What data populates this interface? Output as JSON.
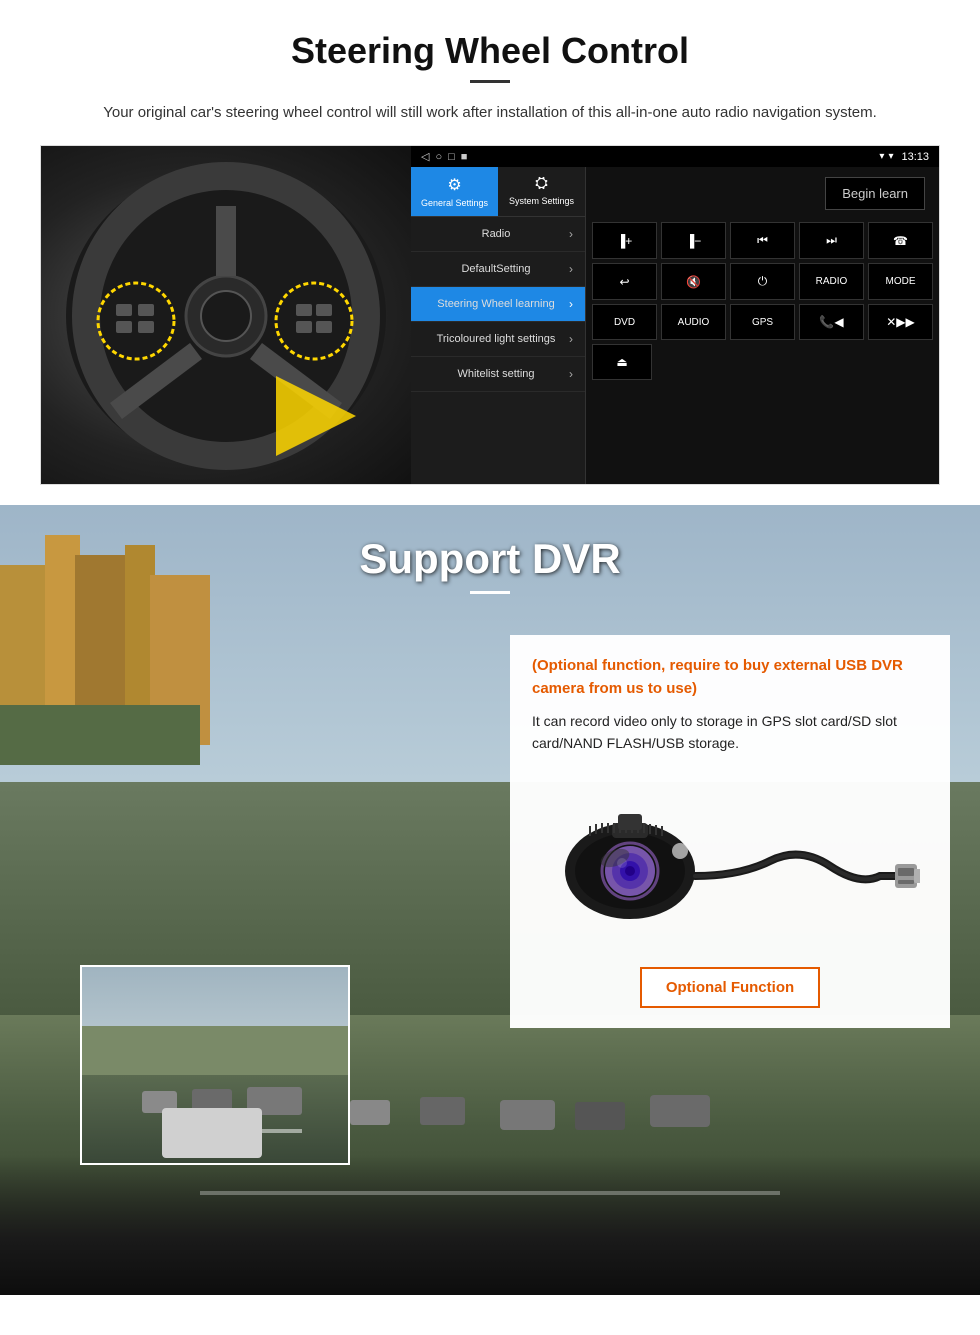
{
  "steering": {
    "title": "Steering Wheel Control",
    "description": "Your original car's steering wheel control will still work after installation of this all-in-one auto radio navigation system.",
    "statusbar": {
      "time": "13:13",
      "signal": "▾"
    },
    "tabs": [
      {
        "label": "General Settings",
        "active": true
      },
      {
        "label": "System Settings",
        "active": false
      }
    ],
    "menu_items": [
      {
        "label": "Radio",
        "active": false
      },
      {
        "label": "DefaultSetting",
        "active": false
      },
      {
        "label": "Steering Wheel learning",
        "active": true
      },
      {
        "label": "Tricoloured light settings",
        "active": false
      },
      {
        "label": "Whitelist setting",
        "active": false
      }
    ],
    "begin_learn_label": "Begin learn",
    "control_buttons": [
      [
        "▐+",
        "▐−",
        "◀◀",
        "▶▶|",
        "☎"
      ],
      [
        "↩",
        "◀× ",
        "⏻",
        "RADIO",
        "MODE"
      ],
      [
        "DVD",
        "AUDIO",
        "GPS",
        "📞◀◀",
        "✕ ▶▶|"
      ],
      [
        "⏏"
      ]
    ]
  },
  "dvr": {
    "title": "Support DVR",
    "optional_text": "(Optional function, require to buy external USB DVR camera from us to use)",
    "description": "It can record video only to storage in GPS slot card/SD slot card/NAND FLASH/USB storage.",
    "optional_function_label": "Optional Function"
  }
}
